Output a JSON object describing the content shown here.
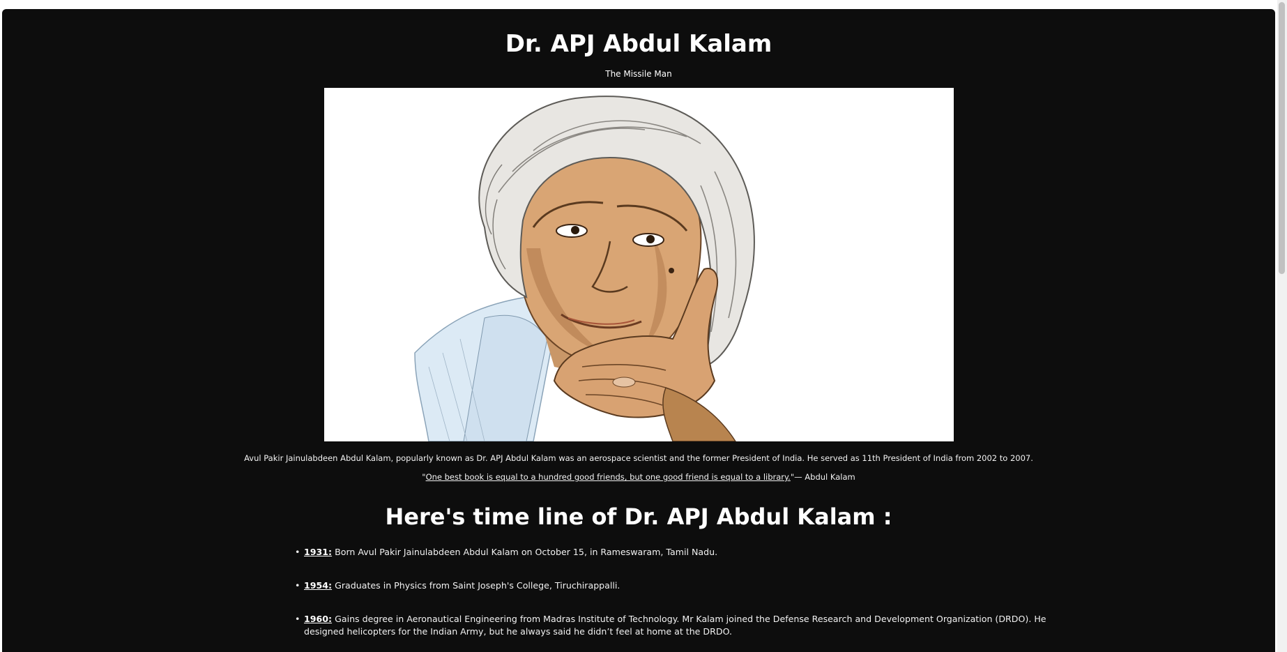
{
  "header": {
    "title": "Dr. APJ Abdul Kalam",
    "subtitle": "The Missile Man"
  },
  "portrait": {
    "alt": "Sketch portrait of Dr. APJ Abdul Kalam"
  },
  "intro": "Avul Pakir Jainulabdeen Abdul Kalam, popularly known as Dr. APJ Abdul Kalam was an aerospace scientist and the former President of India. He served as 11th President of India from 2002 to 2007.",
  "quote": {
    "open": "\"",
    "text": "One best book is equal to a hundred good friends, but one good friend is equal to a library.",
    "close": "\"",
    "author": "— Abdul Kalam"
  },
  "timeline": {
    "heading": "Here's time line of Dr. APJ Abdul Kalam :",
    "items": [
      {
        "year": "1931:",
        "text": " Born Avul Pakir Jainulabdeen Abdul Kalam on October 15, in Rameswaram, Tamil Nadu."
      },
      {
        "year": "1954:",
        "text": " Graduates in Physics from Saint Joseph's College, Tiruchirappalli."
      },
      {
        "year": "1960:",
        "text": " Gains degree in Aeronautical Engineering from Madras Institute of Technology. Mr Kalam joined the Defense Research and Development Organization (DRDO). He designed helicopters for the Indian Army, but he always said he didn’t feel at home at the DRDO."
      }
    ]
  },
  "colors": {
    "page_background": "#0d0d0d",
    "text": "#ffffff",
    "outer_background": "#ffffff"
  }
}
